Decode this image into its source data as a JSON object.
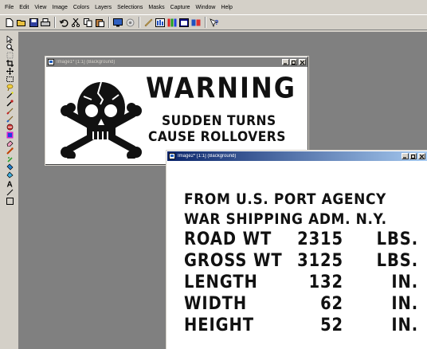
{
  "menu": [
    "File",
    "Edit",
    "View",
    "Image",
    "Colors",
    "Layers",
    "Selections",
    "Masks",
    "Capture",
    "Window",
    "Help"
  ],
  "toolbar_icons": [
    "new-icon",
    "open-icon",
    "save-icon",
    "print-icon",
    "undo-icon",
    "cut-icon",
    "copy-icon",
    "paste-icon",
    "full-screen-icon",
    "browse-icon",
    "palette-icon",
    "histogram-icon",
    "overview-icon",
    "layer-icon",
    "help-icon"
  ],
  "tool_icons": [
    "arrow-tool-icon",
    "zoom-tool-icon",
    "deform-tool-icon",
    "crop-tool-icon",
    "mover-tool-icon",
    "selection-tool-icon",
    "freehand-tool-icon",
    "magic-wand-tool-icon",
    "dropper-tool-icon",
    "paintbrush-tool-icon",
    "clone-brush-tool-icon",
    "color-replacer-tool-icon",
    "retouch-tool-icon",
    "eraser-tool-icon",
    "picture-tube-tool-icon",
    "airbrush-tool-icon",
    "flood-fill-tool-icon",
    "text-tool-icon",
    "line-tool-icon",
    "shapes-tool-icon"
  ],
  "window1": {
    "title": "Image1* [1:1] (Background)",
    "heading": "WARNING",
    "line1": "SUDDEN TURNS",
    "line2": "CAUSE ROLLOVERS"
  },
  "window2": {
    "title": "Image2* [1:1] (Background)",
    "line1": "FROM U.S. PORT AGENCY",
    "line2": "WAR SHIPPING ADM. N.Y.",
    "rows": [
      {
        "label": "ROAD WT",
        "value": "2315",
        "unit": "LBS."
      },
      {
        "label": "GROSS WT",
        "value": "3125",
        "unit": "LBS."
      },
      {
        "label": "LENGTH",
        "value": "132",
        "unit": "IN."
      },
      {
        "label": "WIDTH",
        "value": "62",
        "unit": "IN."
      },
      {
        "label": "HEIGHT",
        "value": "52",
        "unit": "IN."
      }
    ]
  },
  "colors": {
    "chrome": "#d4d0c8",
    "workspace": "#808080",
    "active_title": "#0a246a",
    "inactive_title": "#808080"
  }
}
